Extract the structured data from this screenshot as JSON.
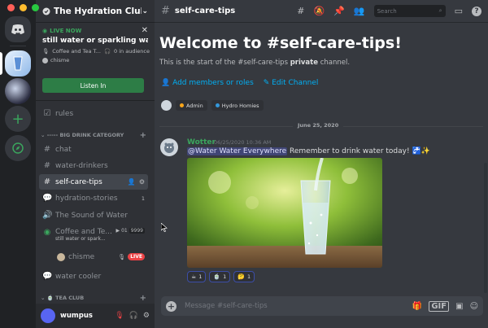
{
  "colors": {
    "accent": "#5865f2",
    "live_green": "#3ba55d",
    "listen_green": "#2d7d46",
    "link": "#00aff4",
    "live_badge": "#ed4245"
  },
  "server": {
    "name": "The Hydration Club"
  },
  "live": {
    "tag": "LIVE NOW",
    "title": "still water or sparkling water",
    "channel": "Coffee and Tea T...",
    "audience": "0 in audience",
    "host": "chisme",
    "listen_label": "Listen In"
  },
  "channels": {
    "rules": "rules",
    "category_drinks": "----- BIG DRINK CATEGORY",
    "chat": "chat",
    "water_drinkers": "water-drinkers",
    "selfcare": "self-care-tips",
    "hydration_stories": "hydration-stories",
    "hydration_stories_count": "1",
    "sound_of_water": "The Sound of Water",
    "coffee_tea": "Coffee and Te...",
    "coffee_tea_sub": "still water or spark...",
    "coffee_tea_listeners": "01",
    "coffee_tea_count": "9999",
    "stage_user": "chisme",
    "live_badge": "LIVE",
    "water_cooler": "water cooler",
    "category_tea": "TEA CLUB"
  },
  "user": {
    "name": "wumpus"
  },
  "topbar": {
    "channel": "self-care-tips",
    "search_placeholder": "Search"
  },
  "welcome": {
    "heading": "Welcome to #self-care-tips!",
    "desc_prefix": "This is the start of the #self-care-tips ",
    "desc_bold": "private",
    "desc_suffix": " channel.",
    "add_members": "Add members or roles",
    "edit_channel": "Edit Channel",
    "roles": [
      {
        "name": "Admin",
        "color": "#faa61a"
      },
      {
        "name": "Hydro Homies",
        "color": "#3498db"
      }
    ]
  },
  "date_divider": "June 25, 2020",
  "message": {
    "author": "Wotter",
    "timestamp": "06/25/2020 10:36 AM",
    "mention": "@Water Water Everywhere",
    "text": " Remember to drink water today! ",
    "emojis": "🚰✨",
    "reactions": [
      {
        "emoji": "☕",
        "count": "1"
      },
      {
        "emoji": "🍵",
        "count": "1"
      },
      {
        "emoji": "🤔",
        "count": "1"
      }
    ]
  },
  "composer": {
    "placeholder": "Message #self-care-tips",
    "gif_label": "GIF"
  }
}
